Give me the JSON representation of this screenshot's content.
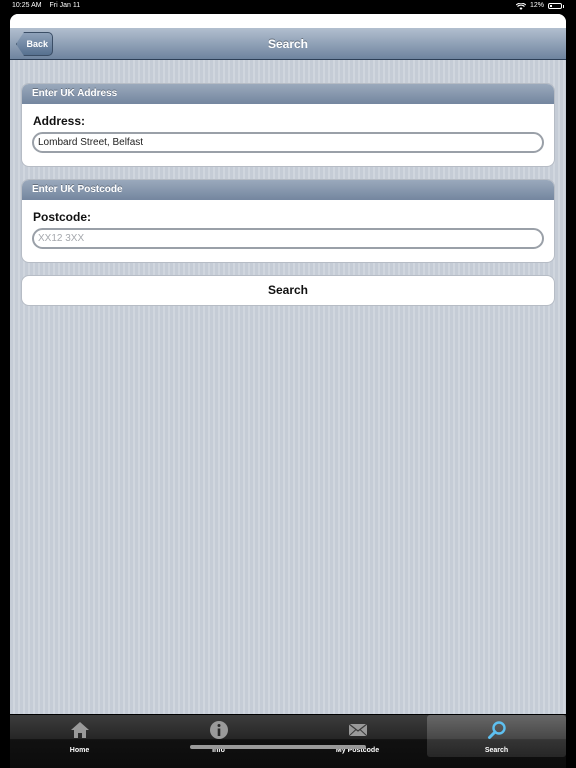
{
  "status_bar": {
    "time": "10:25 AM",
    "date": "Fri Jan 11",
    "battery": "12%",
    "wifi_icon": "wifi-icon",
    "battery_icon": "battery-icon"
  },
  "navbar": {
    "title": "Search",
    "back_label": "Back"
  },
  "address_section": {
    "header": "Enter UK Address",
    "label": "Address:",
    "value": "Lombard Street, Belfast",
    "placeholder": ""
  },
  "postcode_section": {
    "header": "Enter UK Postcode",
    "label": "Postcode:",
    "value": "",
    "placeholder": "XX12 3XX"
  },
  "search_button": "Search",
  "tabs": [
    {
      "label": "Home",
      "icon": "home-icon",
      "active": false
    },
    {
      "label": "Info",
      "icon": "info-icon",
      "active": false
    },
    {
      "label": "My Postcode",
      "icon": "envelope-icon",
      "active": false
    },
    {
      "label": "Search",
      "icon": "magnifier-icon",
      "active": true
    }
  ],
  "colors": {
    "nav_gradient_top": "#b2bfcf",
    "nav_gradient_bottom": "#6f849f",
    "background": "#c7ced7",
    "active_tab_icon": "#5ec0f0"
  }
}
